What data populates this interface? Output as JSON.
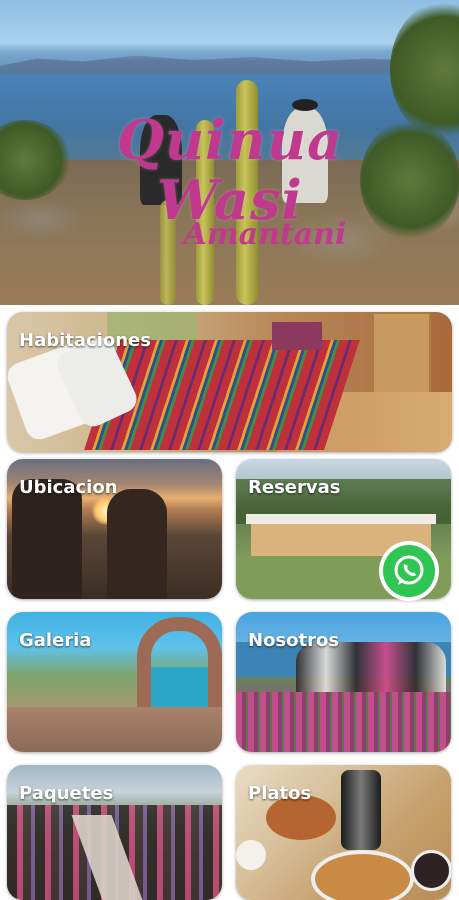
{
  "header": {
    "logo_line1": "Quinua Wasi",
    "logo_line2": "Amantani",
    "logo_color": "#c0398e"
  },
  "menu": {
    "habitaciones": "Habitaciones",
    "ubicacion": "Ubicacion",
    "reservas": "Reservas",
    "galeria": "Galeria",
    "nosotros": "Nosotros",
    "paquetes": "Paquetes",
    "platos": "Platos"
  },
  "fab": {
    "icon": "whatsapp-icon",
    "color": "#2fc553"
  }
}
